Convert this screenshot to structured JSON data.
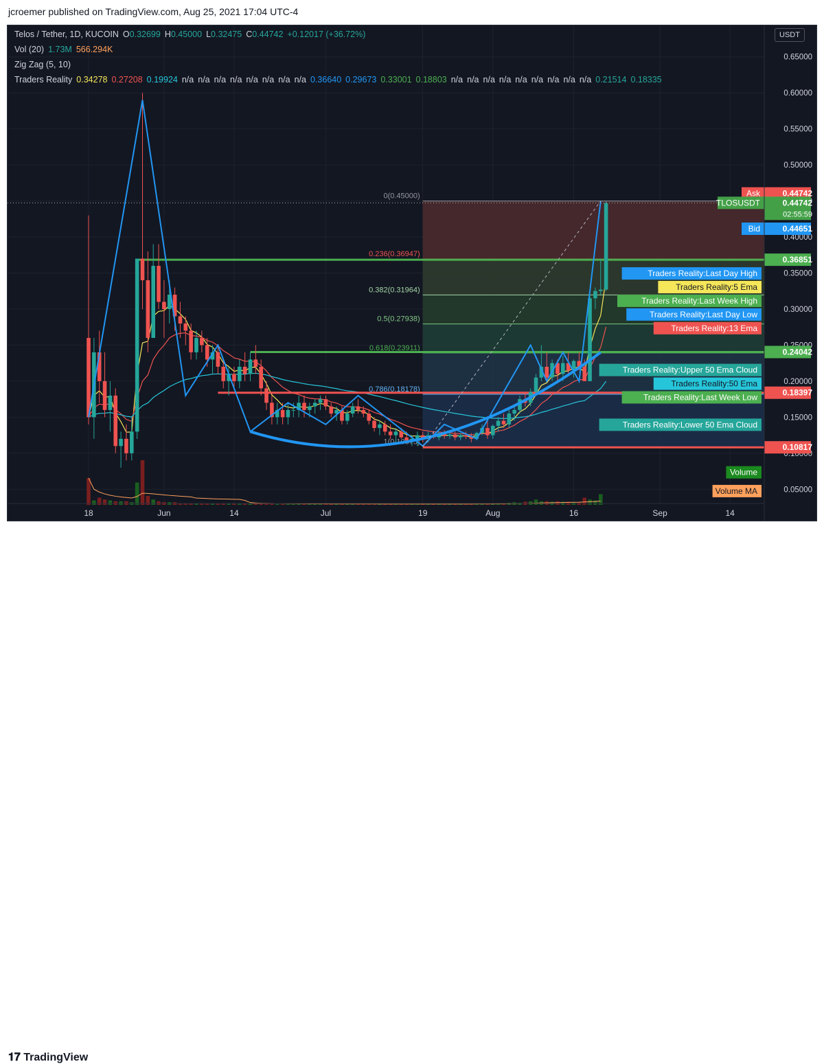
{
  "header": {
    "publisher": "jcroemer published on TradingView.com, Aug 25, 2021 17:04 UTC-4"
  },
  "footer": {
    "brand": "TradingView"
  },
  "legend": {
    "symbol": "Telos / Tether, 1D, KUCOIN",
    "open_label": "O",
    "open": "0.32699",
    "high_label": "H",
    "high": "0.45000",
    "low_label": "L",
    "low": "0.32475",
    "close_label": "C",
    "close": "0.44742",
    "change": "+0.12017 (+36.72%)",
    "vol_label": "Vol (20)",
    "vol_value": "1.73M",
    "vol_ma": "566.294K",
    "zigzag_label": "Zig Zag (5, 10)",
    "tr_label": "Traders Reality",
    "tr_values": [
      {
        "v": "0.34278",
        "c": "#f5e65a"
      },
      {
        "v": "0.27208",
        "c": "#f05350"
      },
      {
        "v": "0.19924",
        "c": "#26c6da"
      },
      {
        "v": "n/a",
        "c": "#d1d4dc"
      },
      {
        "v": "n/a",
        "c": "#d1d4dc"
      },
      {
        "v": "n/a",
        "c": "#d1d4dc"
      },
      {
        "v": "n/a",
        "c": "#d1d4dc"
      },
      {
        "v": "n/a",
        "c": "#d1d4dc"
      },
      {
        "v": "n/a",
        "c": "#d1d4dc"
      },
      {
        "v": "n/a",
        "c": "#d1d4dc"
      },
      {
        "v": "n/a",
        "c": "#d1d4dc"
      },
      {
        "v": "0.36640",
        "c": "#2196f3"
      },
      {
        "v": "0.29673",
        "c": "#2196f3"
      },
      {
        "v": "0.33001",
        "c": "#4caf50"
      },
      {
        "v": "0.18803",
        "c": "#4caf50"
      },
      {
        "v": "n/a",
        "c": "#d1d4dc"
      },
      {
        "v": "n/a",
        "c": "#d1d4dc"
      },
      {
        "v": "n/a",
        "c": "#d1d4dc"
      },
      {
        "v": "n/a",
        "c": "#d1d4dc"
      },
      {
        "v": "n/a",
        "c": "#d1d4dc"
      },
      {
        "v": "n/a",
        "c": "#d1d4dc"
      },
      {
        "v": "n/a",
        "c": "#d1d4dc"
      },
      {
        "v": "n/a",
        "c": "#d1d4dc"
      },
      {
        "v": "n/a",
        "c": "#d1d4dc"
      },
      {
        "v": "0.21514",
        "c": "#26a69a"
      },
      {
        "v": "0.18335",
        "c": "#26a69a"
      }
    ]
  },
  "colors": {
    "background": "#131722",
    "up": "#26a69a",
    "down": "#ef5350",
    "grid": "#1e222d",
    "axis_text": "#d1d4dc",
    "zigzag": "#2196f3",
    "ema5": "#f5e65a",
    "ema13": "#ef5350",
    "ema50": "#26c6da",
    "level_green": "#4caf50",
    "level_red": "#ef5350"
  },
  "chart_data": {
    "type": "candlestick",
    "currency": "USDT",
    "y_ticks": [
      "0.65000",
      "0.60000",
      "0.55000",
      "0.50000",
      "0.45000",
      "0.40000",
      "0.35000",
      "0.30000",
      "0.25000",
      "0.20000",
      "0.15000",
      "0.10000",
      "0.05000"
    ],
    "y_range": [
      0.015,
      0.665
    ],
    "x_ticks": [
      {
        "label": "18",
        "day": 0
      },
      {
        "label": "Jun",
        "day": 14
      },
      {
        "label": "14",
        "day": 27
      },
      {
        "label": "Jul",
        "day": 44
      },
      {
        "label": "19",
        "day": 62
      },
      {
        "label": "Aug",
        "day": 75
      },
      {
        "label": "16",
        "day": 90
      },
      {
        "label": "Sep",
        "day": 106
      },
      {
        "label": "14",
        "day": 119
      }
    ],
    "candles": [
      [
        0.26,
        0.43,
        0.14,
        0.15
      ],
      [
        0.15,
        0.26,
        0.12,
        0.24
      ],
      [
        0.24,
        0.27,
        0.17,
        0.2
      ],
      [
        0.2,
        0.24,
        0.15,
        0.16
      ],
      [
        0.16,
        0.2,
        0.13,
        0.18
      ],
      [
        0.18,
        0.19,
        0.1,
        0.11
      ],
      [
        0.11,
        0.13,
        0.08,
        0.12
      ],
      [
        0.12,
        0.14,
        0.09,
        0.1
      ],
      [
        0.1,
        0.15,
        0.09,
        0.13
      ],
      [
        0.13,
        0.37,
        0.12,
        0.37
      ],
      [
        0.37,
        0.6,
        0.3,
        0.34
      ],
      [
        0.34,
        0.38,
        0.24,
        0.26
      ],
      [
        0.26,
        0.39,
        0.26,
        0.36
      ],
      [
        0.36,
        0.39,
        0.3,
        0.31
      ],
      [
        0.31,
        0.34,
        0.26,
        0.3
      ],
      [
        0.3,
        0.34,
        0.28,
        0.32
      ],
      [
        0.32,
        0.33,
        0.27,
        0.29
      ],
      [
        0.29,
        0.31,
        0.26,
        0.28
      ],
      [
        0.28,
        0.29,
        0.25,
        0.27
      ],
      [
        0.27,
        0.28,
        0.23,
        0.24
      ],
      [
        0.24,
        0.27,
        0.23,
        0.26
      ],
      [
        0.26,
        0.27,
        0.24,
        0.25
      ],
      [
        0.25,
        0.26,
        0.22,
        0.23
      ],
      [
        0.23,
        0.25,
        0.21,
        0.24
      ],
      [
        0.24,
        0.25,
        0.21,
        0.22
      ],
      [
        0.22,
        0.23,
        0.19,
        0.2
      ],
      [
        0.2,
        0.22,
        0.18,
        0.21
      ],
      [
        0.21,
        0.22,
        0.19,
        0.2
      ],
      [
        0.2,
        0.23,
        0.19,
        0.22
      ],
      [
        0.22,
        0.24,
        0.2,
        0.21
      ],
      [
        0.21,
        0.24,
        0.2,
        0.23
      ],
      [
        0.23,
        0.25,
        0.21,
        0.22
      ],
      [
        0.22,
        0.23,
        0.18,
        0.19
      ],
      [
        0.19,
        0.2,
        0.16,
        0.17
      ],
      [
        0.17,
        0.18,
        0.14,
        0.15
      ],
      [
        0.15,
        0.17,
        0.14,
        0.16
      ],
      [
        0.16,
        0.17,
        0.14,
        0.15
      ],
      [
        0.15,
        0.17,
        0.14,
        0.16
      ],
      [
        0.16,
        0.17,
        0.15,
        0.16
      ],
      [
        0.16,
        0.18,
        0.15,
        0.17
      ],
      [
        0.17,
        0.18,
        0.15,
        0.16
      ],
      [
        0.16,
        0.17,
        0.15,
        0.165
      ],
      [
        0.165,
        0.175,
        0.155,
        0.17
      ],
      [
        0.17,
        0.18,
        0.16,
        0.175
      ],
      [
        0.175,
        0.18,
        0.16,
        0.165
      ],
      [
        0.165,
        0.17,
        0.15,
        0.155
      ],
      [
        0.155,
        0.165,
        0.145,
        0.16
      ],
      [
        0.16,
        0.165,
        0.14,
        0.145
      ],
      [
        0.145,
        0.16,
        0.14,
        0.155
      ],
      [
        0.155,
        0.17,
        0.15,
        0.165
      ],
      [
        0.165,
        0.175,
        0.155,
        0.16
      ],
      [
        0.16,
        0.165,
        0.15,
        0.155
      ],
      [
        0.155,
        0.16,
        0.14,
        0.145
      ],
      [
        0.145,
        0.15,
        0.13,
        0.135
      ],
      [
        0.135,
        0.145,
        0.125,
        0.14
      ],
      [
        0.14,
        0.145,
        0.125,
        0.13
      ],
      [
        0.13,
        0.14,
        0.12,
        0.125
      ],
      [
        0.125,
        0.135,
        0.115,
        0.13
      ],
      [
        0.13,
        0.135,
        0.12,
        0.122
      ],
      [
        0.122,
        0.13,
        0.115,
        0.118
      ],
      [
        0.118,
        0.125,
        0.11,
        0.12
      ],
      [
        0.12,
        0.13,
        0.11,
        0.125
      ],
      [
        0.125,
        0.13,
        0.115,
        0.12
      ],
      [
        0.12,
        0.13,
        0.115,
        0.125
      ],
      [
        0.125,
        0.13,
        0.12,
        0.122
      ],
      [
        0.122,
        0.13,
        0.118,
        0.128
      ],
      [
        0.128,
        0.132,
        0.12,
        0.124
      ],
      [
        0.124,
        0.13,
        0.12,
        0.126
      ],
      [
        0.126,
        0.13,
        0.118,
        0.122
      ],
      [
        0.122,
        0.128,
        0.118,
        0.125
      ],
      [
        0.125,
        0.13,
        0.12,
        0.123
      ],
      [
        0.123,
        0.128,
        0.115,
        0.12
      ],
      [
        0.12,
        0.13,
        0.118,
        0.128
      ],
      [
        0.128,
        0.14,
        0.125,
        0.135
      ],
      [
        0.135,
        0.145,
        0.12,
        0.125
      ],
      [
        0.125,
        0.14,
        0.12,
        0.138
      ],
      [
        0.138,
        0.15,
        0.13,
        0.145
      ],
      [
        0.145,
        0.155,
        0.135,
        0.14
      ],
      [
        0.14,
        0.16,
        0.135,
        0.155
      ],
      [
        0.155,
        0.165,
        0.145,
        0.16
      ],
      [
        0.16,
        0.18,
        0.155,
        0.175
      ],
      [
        0.175,
        0.185,
        0.165,
        0.17
      ],
      [
        0.17,
        0.19,
        0.165,
        0.185
      ],
      [
        0.185,
        0.21,
        0.18,
        0.205
      ],
      [
        0.205,
        0.25,
        0.2,
        0.22
      ],
      [
        0.22,
        0.24,
        0.2,
        0.205
      ],
      [
        0.205,
        0.23,
        0.2,
        0.225
      ],
      [
        0.225,
        0.23,
        0.2,
        0.21
      ],
      [
        0.21,
        0.235,
        0.2,
        0.225
      ],
      [
        0.225,
        0.24,
        0.21,
        0.215
      ],
      [
        0.215,
        0.23,
        0.205,
        0.228
      ],
      [
        0.228,
        0.24,
        0.215,
        0.22
      ],
      [
        0.22,
        0.23,
        0.2,
        0.2
      ],
      [
        0.2,
        0.32,
        0.2,
        0.315
      ],
      [
        0.315,
        0.33,
        0.3,
        0.325
      ],
      [
        0.325,
        0.37,
        0.32,
        0.327
      ],
      [
        0.327,
        0.45,
        0.325,
        0.447
      ]
    ],
    "volumes": [
      0.3,
      0.05,
      0.08,
      0.06,
      0.05,
      0.04,
      0.04,
      0.04,
      0.03,
      0.25,
      0.5,
      0.1,
      0.06,
      0.04,
      0.03,
      0.03,
      0.03,
      0.02,
      0.02,
      0.02,
      0.02,
      0.02,
      0.015,
      0.015,
      0.015,
      0.015,
      0.012,
      0.012,
      0.012,
      0.012,
      0.012,
      0.012,
      0.012,
      0.012,
      0.012,
      0.01,
      0.01,
      0.01,
      0.01,
      0.01,
      0.01,
      0.01,
      0.01,
      0.01,
      0.01,
      0.01,
      0.01,
      0.01,
      0.01,
      0.01,
      0.01,
      0.01,
      0.01,
      0.01,
      0.01,
      0.01,
      0.01,
      0.01,
      0.01,
      0.01,
      0.01,
      0.01,
      0.01,
      0.01,
      0.01,
      0.01,
      0.01,
      0.01,
      0.01,
      0.01,
      0.01,
      0.01,
      0.012,
      0.012,
      0.014,
      0.015,
      0.02,
      0.02,
      0.025,
      0.03,
      0.025,
      0.035,
      0.04,
      0.06,
      0.04,
      0.04,
      0.035,
      0.04,
      0.035,
      0.035,
      0.03,
      0.03,
      0.08,
      0.06,
      0.05,
      0.12
    ],
    "fib": {
      "levels": [
        {
          "label": "0(0.45000)",
          "price": 0.45,
          "color": "#9598a1",
          "fill": "#4a2a2e"
        },
        {
          "label": "0.236(0.36947)",
          "price": 0.36947,
          "color": "#f05350",
          "fill": "#2f3b2e"
        },
        {
          "label": "0.382(0.31964)",
          "price": 0.31964,
          "color": "#a5d6a7",
          "fill": "#243c2b"
        },
        {
          "label": "0.5(0.27938)",
          "price": 0.27938,
          "color": "#81c784",
          "fill": "#1e3d35"
        },
        {
          "label": "0.618(0.23911)",
          "price": 0.23911,
          "color": "#4caf50",
          "fill": "#1f3346"
        },
        {
          "label": "0.786(0.18178)",
          "price": 0.18178,
          "color": "#64b5f6",
          "fill": "#1c2e4a"
        },
        {
          "label": "1(0.10875)",
          "price": 0.10875,
          "color": "#9598a1",
          "fill": ""
        }
      ],
      "start_day": 62
    },
    "horizontal_levels": [
      {
        "price": 0.36851,
        "color": "#4caf50",
        "from_day": 9
      },
      {
        "price": 0.24042,
        "color": "#4caf50",
        "from_day": 30
      },
      {
        "price": 0.18397,
        "color": "#ef5350",
        "from_day": 24
      },
      {
        "price": 0.10817,
        "color": "#ef5350",
        "from_day": 62
      }
    ],
    "zigzag": [
      [
        0,
        0.15
      ],
      [
        10,
        0.59
      ],
      [
        18,
        0.18
      ],
      [
        24,
        0.25
      ],
      [
        30,
        0.13
      ],
      [
        37,
        0.17
      ],
      [
        44,
        0.14
      ],
      [
        50,
        0.18
      ],
      [
        62,
        0.11
      ],
      [
        66,
        0.14
      ],
      [
        72,
        0.12
      ],
      [
        82,
        0.25
      ],
      [
        85,
        0.2
      ],
      [
        88,
        0.24
      ],
      [
        91,
        0.2
      ],
      [
        95,
        0.45
      ]
    ],
    "cup_arc": [
      [
        30,
        0.13
      ],
      [
        62,
        0.085
      ],
      [
        95,
        0.24
      ]
    ],
    "axis_price_labels": [
      {
        "label": "Ask",
        "value": "0.44742",
        "price": 0.4605,
        "color": "#ef5350"
      },
      {
        "label": "TLOSUSDT",
        "value": "0.44742",
        "price": 0.4474,
        "color": "#43a047",
        "sub": "02:55:59"
      },
      {
        "label": "Bid",
        "value": "0.44651",
        "price": 0.4115,
        "color": "#2196f3"
      },
      {
        "label": "",
        "value": "0.36851",
        "price": 0.36851,
        "color": "#4caf50"
      },
      {
        "label": "",
        "value": "0.24042",
        "price": 0.24042,
        "color": "#4caf50"
      },
      {
        "label": "",
        "value": "0.18397",
        "price": 0.18397,
        "color": "#ef5350"
      },
      {
        "label": "",
        "value": "0.10817",
        "price": 0.10817,
        "color": "#ef5350"
      }
    ],
    "indicator_labels": [
      {
        "text": "Traders Reality:Last Day High",
        "price": 0.3495,
        "color": "#2196f3",
        "text_color": "#ffffff"
      },
      {
        "text": "Traders Reality:5 Ema",
        "price": 0.3305,
        "color": "#f5e65a",
        "text_color": "#131722"
      },
      {
        "text": "Traders Reality:Last Week High",
        "price": 0.3115,
        "color": "#4caf50",
        "text_color": "#ffffff"
      },
      {
        "text": "Traders Reality:Last Day Low",
        "price": 0.2925,
        "color": "#2196f3",
        "text_color": "#ffffff"
      },
      {
        "text": "Traders Reality:13 Ema",
        "price": 0.2735,
        "color": "#ef5350",
        "text_color": "#ffffff"
      },
      {
        "text": "Traders Reality:Upper 50 Ema Cloud",
        "price": 0.2155,
        "color": "#26a69a",
        "text_color": "#ffffff"
      },
      {
        "text": "Traders Reality:50 Ema",
        "price": 0.1965,
        "color": "#26c6da",
        "text_color": "#131722"
      },
      {
        "text": "Traders Reality:Last Week Low",
        "price": 0.1775,
        "color": "#4caf50",
        "text_color": "#ffffff"
      },
      {
        "text": "Traders Reality:Lower 50 Ema Cloud",
        "price": 0.1395,
        "color": "#26a69a",
        "text_color": "#ffffff"
      },
      {
        "text": "Volume",
        "price": 0.0735,
        "color": "#1b8a1f",
        "text_color": "#ffffff"
      },
      {
        "text": "Volume MA",
        "price": 0.0475,
        "color": "#ffa15c",
        "text_color": "#131722"
      }
    ]
  }
}
